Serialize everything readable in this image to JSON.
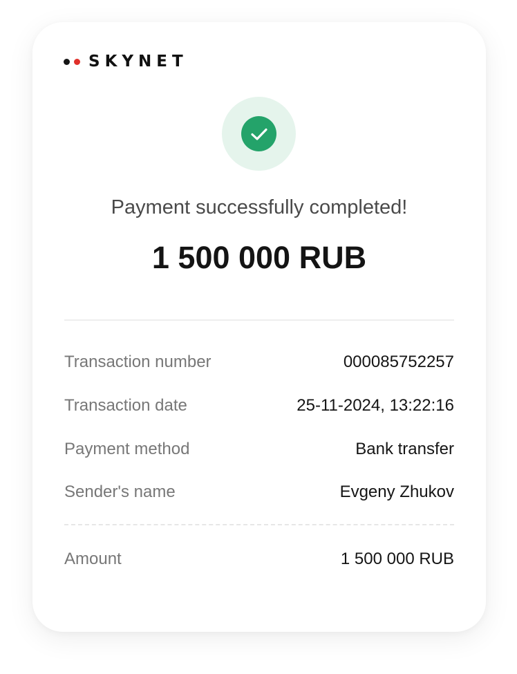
{
  "brand": {
    "name": "SKYNET",
    "logo_icon": "two-dots-logo-icon",
    "dot_colors": [
      "#151515",
      "#e0302a"
    ]
  },
  "status": {
    "icon": "check-icon",
    "ring_color": "#e5f4ec",
    "fill_color": "#24a36a"
  },
  "headline": "Payment successfully completed!",
  "amount_display": "1 500 000 RUB",
  "details": [
    {
      "label": "Transaction number",
      "value": "000085752257"
    },
    {
      "label": "Transaction date",
      "value": "25-11-2024, 13:22:16"
    },
    {
      "label": "Payment method",
      "value": "Bank transfer"
    },
    {
      "label": "Sender's name",
      "value": "Evgeny Zhukov"
    }
  ],
  "total": {
    "label": "Amount",
    "value": "1 500 000 RUB"
  }
}
